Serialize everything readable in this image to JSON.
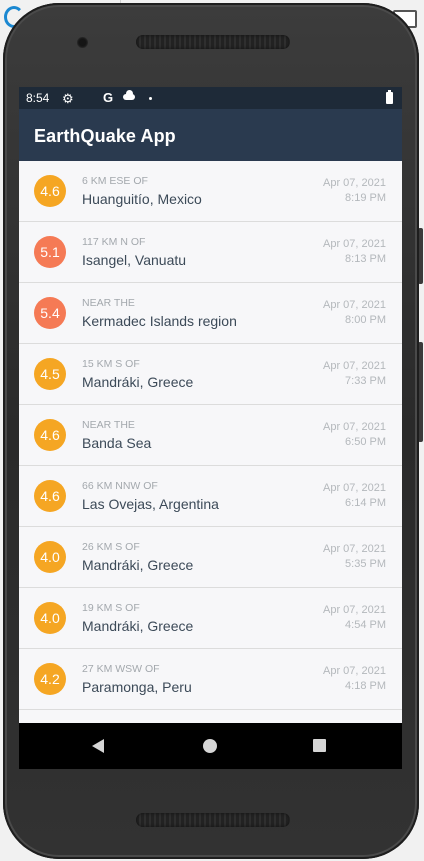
{
  "status_bar": {
    "time": "8:54",
    "google_letter": "G"
  },
  "app_bar": {
    "title": "EarthQuake App"
  },
  "colors": {
    "appbar": "#2a3a4f",
    "statusbar": "#1e2a38",
    "mag_orange": "#f5a623",
    "mag_red": "#f57a55"
  },
  "earthquakes": [
    {
      "magnitude": "4.6",
      "offset": "6 KM ESE OF",
      "place": "Huanguitío, Mexico",
      "date": "Apr 07, 2021",
      "time": "8:19 PM",
      "color": "#f5a623"
    },
    {
      "magnitude": "5.1",
      "offset": "117 KM N OF",
      "place": "Isangel, Vanuatu",
      "date": "Apr 07, 2021",
      "time": "8:13 PM",
      "color": "#f57a55"
    },
    {
      "magnitude": "5.4",
      "offset": "NEAR THE",
      "place": "Kermadec Islands region",
      "date": "Apr 07, 2021",
      "time": "8:00 PM",
      "color": "#f57a55"
    },
    {
      "magnitude": "4.5",
      "offset": "15 KM S OF",
      "place": "Mandráki, Greece",
      "date": "Apr 07, 2021",
      "time": "7:33 PM",
      "color": "#f5a623"
    },
    {
      "magnitude": "4.6",
      "offset": "NEAR THE",
      "place": "Banda Sea",
      "date": "Apr 07, 2021",
      "time": "6:50 PM",
      "color": "#f5a623"
    },
    {
      "magnitude": "4.6",
      "offset": "66 KM NNW OF",
      "place": "Las Ovejas, Argentina",
      "date": "Apr 07, 2021",
      "time": "6:14 PM",
      "color": "#f5a623"
    },
    {
      "magnitude": "4.0",
      "offset": "26 KM S OF",
      "place": "Mandráki, Greece",
      "date": "Apr 07, 2021",
      "time": "5:35 PM",
      "color": "#f5a623"
    },
    {
      "magnitude": "4.0",
      "offset": "19 KM S OF",
      "place": "Mandráki, Greece",
      "date": "Apr 07, 2021",
      "time": "4:54 PM",
      "color": "#f5a623"
    },
    {
      "magnitude": "4.2",
      "offset": "27 KM WSW OF",
      "place": "Paramonga, Peru",
      "date": "Apr 07, 2021",
      "time": "4:18 PM",
      "color": "#f5a623"
    },
    {
      "magnitude": "",
      "offset": "",
      "place": "",
      "date": "",
      "time": "",
      "color": "#f57a55"
    }
  ],
  "nav_bar": {
    "back_icon": "back-triangle-icon",
    "home_icon": "home-circle-icon",
    "recents_icon": "recents-square-icon"
  }
}
